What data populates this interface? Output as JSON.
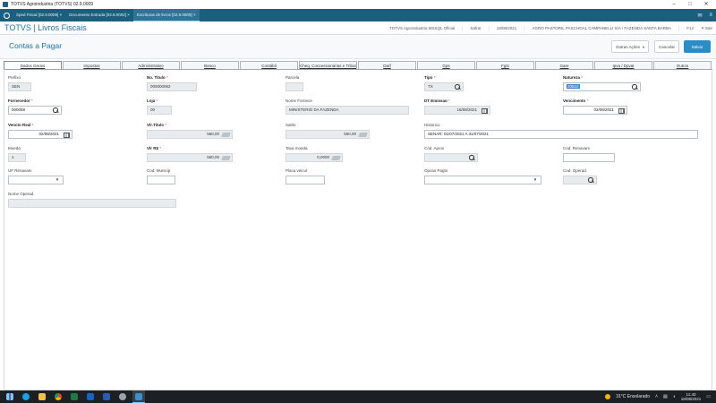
{
  "window": {
    "title": "TOTVS Agroindustria (TOTVS) 02.9.0009",
    "minimize": "–",
    "maximize": "□",
    "close": "✕"
  },
  "tabstrip": {
    "tabs": [
      {
        "label": "Sped Fiscal [02.9.0009]",
        "active": false
      },
      {
        "label": "Documento Entrada [02.9.0002]",
        "active": false
      },
      {
        "label": "Escrituras de livros [02.9.0009]",
        "active": true
      }
    ],
    "close_glyph": "×",
    "mail_glyph": "✉",
    "menu_glyph": "≡"
  },
  "appbar": {
    "brand": "TOTVS | Livros Fiscais",
    "meta": [
      "TOTVS Agroindustria MSSQL Oficial",
      "Safrar",
      "18/08/2021",
      "AGRO PASTORIL PASCHOAL CAMPANELLI S/A / FAZENDA SANTA BARBA",
      "F12"
    ],
    "close_label": "Sair"
  },
  "page": {
    "title": "Contas a Pagar",
    "buttons": {
      "other": "Outras Ações",
      "cancel": "Cancelar",
      "save": "Salvar"
    }
  },
  "tabs": [
    "Dados Gerais",
    "Impostos",
    "Administrativo",
    "Banco",
    "Contábil",
    "Cheq. Concessionárias e Tributo",
    "Darf",
    "Gps",
    "Fgts",
    "Gare",
    "Ipva / Dpvat",
    "Outros"
  ],
  "fields": {
    "prefixo": {
      "label": "Prefixo",
      "value": "SEN"
    },
    "no_titulo": {
      "label": "No. Titulo",
      "value": "000000062"
    },
    "parcela": {
      "label": "Parcela",
      "value": ""
    },
    "tipo": {
      "label": "Tipo",
      "value": "TX"
    },
    "natureza": {
      "label": "Natureza",
      "value": "20810"
    },
    "fornecedor": {
      "label": "Fornecedor",
      "value": "000058"
    },
    "loja": {
      "label": "Loja",
      "value": "00"
    },
    "nome_fornece": {
      "label": "Nome Fornece",
      "value": "MINISTERIO DA FAZENDA"
    },
    "dt_emissao": {
      "label": "DT Emissao",
      "value": "18/08/2021"
    },
    "vencimento": {
      "label": "Vencimento",
      "value": "02/08/2021"
    },
    "vencto_real": {
      "label": "Vencto Real",
      "value": "02/08/2021"
    },
    "vlr_titulo": {
      "label": "Vlr.Titulo",
      "value": "560,00"
    },
    "saldo": {
      "label": "Saldo",
      "value": "560,00"
    },
    "historico": {
      "label": "Historico",
      "value": "SENAR: 01/07/2021 A 31/07/2021"
    },
    "moeda": {
      "label": "Moeda",
      "value": "1"
    },
    "vlr_rs": {
      "label": "Vlr R$",
      "value": "560,00"
    },
    "taxa_moeda": {
      "label": "Taxa moeda",
      "value": "0,0000"
    },
    "cod_aprov": {
      "label": "Cód. Aprov",
      "value": ""
    },
    "cod_renavam": {
      "label": "Cod. Renavam",
      "value": ""
    },
    "uf_renavam": {
      "label": "UF Renavam",
      "value": ""
    },
    "cod_municip": {
      "label": "Cod. Municip",
      "value": ""
    },
    "placa_veicul": {
      "label": "Placa veicul",
      "value": ""
    },
    "opcao_pagto": {
      "label": "Opcao Pagto",
      "value": ""
    },
    "cod_operad": {
      "label": "Cod. Operad.",
      "value": ""
    },
    "nome_operad": {
      "label": "Nome Operad.",
      "value": ""
    }
  },
  "taskbar": {
    "weather": "31°C  Ensolarado",
    "time": "11:40",
    "date": "18/08/2021"
  },
  "colors": {
    "tabstrip": "#1c5f7d",
    "brand": "#1d73a8",
    "primary_button": "#2c8dc6",
    "required": "#dd3333"
  }
}
